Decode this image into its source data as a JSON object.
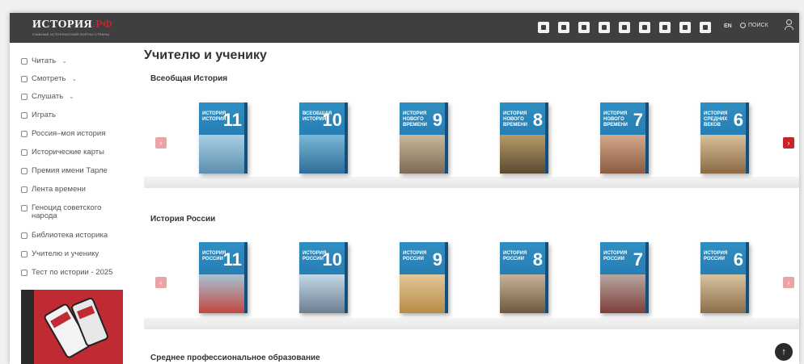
{
  "header": {
    "logo_title_main": "ИСТОРИЯ",
    "logo_title_accent": ".РФ",
    "logo_subtitle": "ГЛАВНЫЙ ИСТОРИЧЕСКИЙ ПОРТАЛ СТРАНЫ",
    "social_icons": [
      "ok-icon",
      "telegram-icon",
      "vk-icon",
      "youtube-icon",
      "rutube-icon",
      "dzen-icon",
      "music-icon",
      "video-icon",
      "mail-icon"
    ],
    "lang_label": "EN",
    "search_label": "ПОИСК"
  },
  "sidebar": {
    "items": [
      {
        "label": "Читать",
        "has_chevron": true
      },
      {
        "label": "Смотреть",
        "has_chevron": true
      },
      {
        "label": "Слушать",
        "has_chevron": true
      },
      {
        "label": "Играть",
        "has_chevron": false
      },
      {
        "label": "Россия–моя история",
        "has_chevron": false
      },
      {
        "label": "Исторические карты",
        "has_chevron": false
      },
      {
        "label": "Премия имени Тарле",
        "has_chevron": false
      },
      {
        "label": "Лента времени",
        "has_chevron": false
      },
      {
        "label": "Геноцид советского народа",
        "has_chevron": false
      },
      {
        "label": "Библиотека историка",
        "has_chevron": false
      },
      {
        "label": "Учителю и ученику",
        "has_chevron": false
      },
      {
        "label": "Тест по истории - 2025",
        "has_chevron": false
      }
    ],
    "chevron": "⌄"
  },
  "main": {
    "page_title": "Учителю и ученику",
    "sections": [
      {
        "title": "Всеобщая История",
        "books": [
          {
            "title": "ИСТОРИЯ ИСТОРИЯ",
            "grade": "11"
          },
          {
            "title": "ВСЕОБЩАЯ ИСТОРИЯ",
            "grade": "10"
          },
          {
            "title": "ИСТОРИЯ НОВОГО ВРЕМЕНИ",
            "grade": "9"
          },
          {
            "title": "ИСТОРИЯ НОВОГО ВРЕМЕНИ",
            "grade": "8"
          },
          {
            "title": "ИСТОРИЯ НОВОГО ВРЕМЕНИ",
            "grade": "7"
          },
          {
            "title": "ИСТОРИЯ СРЕДНИХ ВЕКОВ",
            "grade": "6"
          }
        ]
      },
      {
        "title": "История России",
        "books": [
          {
            "title": "ИСТОРИЯ РОССИИ",
            "grade": "11"
          },
          {
            "title": "ИСТОРИЯ РОССИИ",
            "grade": "10"
          },
          {
            "title": "ИСТОРИЯ РОССИИ",
            "grade": "9"
          },
          {
            "title": "ИСТОРИЯ РОССИИ",
            "grade": "8"
          },
          {
            "title": "ИСТОРИЯ РОССИИ",
            "grade": "7"
          },
          {
            "title": "ИСТОРИЯ РОССИИ",
            "grade": "6"
          }
        ]
      },
      {
        "title": "Среднее профессиональное образование",
        "books": []
      }
    ],
    "prev_arrow": "‹",
    "next_arrow": "›"
  },
  "scroll_top_icon": "↑",
  "colors": {
    "header_bg": "#3f3f3f",
    "accent_red": "#c9232c",
    "book_blue": "#2f8fc2"
  }
}
